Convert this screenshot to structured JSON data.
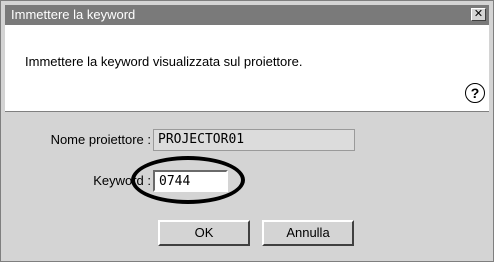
{
  "dialog": {
    "title": "Immettere la keyword",
    "close_label": "✕",
    "message": "Immettere la keyword visualizzata sul proiettore.",
    "help_glyph": "?",
    "projector_name_label": "Nome proiettore :",
    "projector_name_value": "PROJECTOR01",
    "keyword_label": "Keyword :",
    "keyword_value": "0744",
    "ok_label": "OK",
    "cancel_label": "Annulla"
  },
  "icons": {
    "close": "close-icon",
    "help": "help-icon"
  },
  "colors": {
    "title_bar": "#7a7a7a",
    "dialog_face": "#d4d4d4",
    "header_bg": "#ffffff",
    "readonly_field": "#dcdcdc"
  }
}
